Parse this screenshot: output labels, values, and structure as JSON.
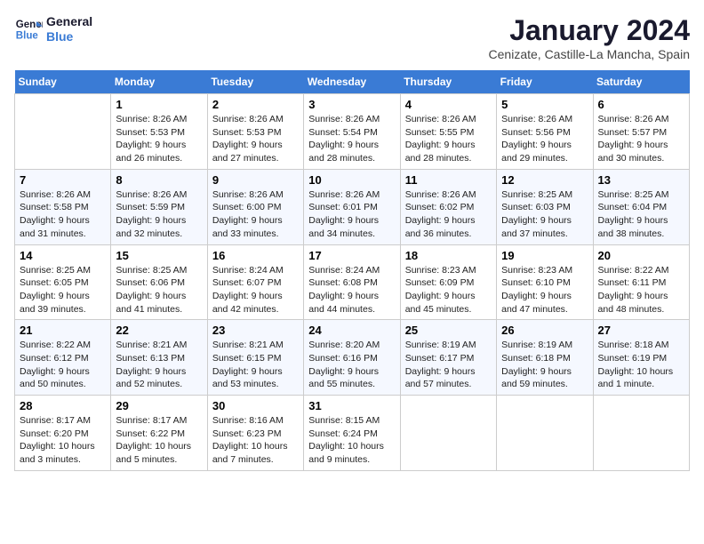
{
  "header": {
    "logo_line1": "General",
    "logo_line2": "Blue",
    "month_year": "January 2024",
    "location": "Cenizate, Castille-La Mancha, Spain"
  },
  "weekdays": [
    "Sunday",
    "Monday",
    "Tuesday",
    "Wednesday",
    "Thursday",
    "Friday",
    "Saturday"
  ],
  "weeks": [
    [
      {
        "num": "",
        "empty": true
      },
      {
        "num": "1",
        "sunrise": "8:26 AM",
        "sunset": "5:53 PM",
        "daylight": "9 hours and 26 minutes."
      },
      {
        "num": "2",
        "sunrise": "8:26 AM",
        "sunset": "5:53 PM",
        "daylight": "9 hours and 27 minutes."
      },
      {
        "num": "3",
        "sunrise": "8:26 AM",
        "sunset": "5:54 PM",
        "daylight": "9 hours and 28 minutes."
      },
      {
        "num": "4",
        "sunrise": "8:26 AM",
        "sunset": "5:55 PM",
        "daylight": "9 hours and 28 minutes."
      },
      {
        "num": "5",
        "sunrise": "8:26 AM",
        "sunset": "5:56 PM",
        "daylight": "9 hours and 29 minutes."
      },
      {
        "num": "6",
        "sunrise": "8:26 AM",
        "sunset": "5:57 PM",
        "daylight": "9 hours and 30 minutes."
      }
    ],
    [
      {
        "num": "7",
        "sunrise": "8:26 AM",
        "sunset": "5:58 PM",
        "daylight": "9 hours and 31 minutes."
      },
      {
        "num": "8",
        "sunrise": "8:26 AM",
        "sunset": "5:59 PM",
        "daylight": "9 hours and 32 minutes."
      },
      {
        "num": "9",
        "sunrise": "8:26 AM",
        "sunset": "6:00 PM",
        "daylight": "9 hours and 33 minutes."
      },
      {
        "num": "10",
        "sunrise": "8:26 AM",
        "sunset": "6:01 PM",
        "daylight": "9 hours and 34 minutes."
      },
      {
        "num": "11",
        "sunrise": "8:26 AM",
        "sunset": "6:02 PM",
        "daylight": "9 hours and 36 minutes."
      },
      {
        "num": "12",
        "sunrise": "8:25 AM",
        "sunset": "6:03 PM",
        "daylight": "9 hours and 37 minutes."
      },
      {
        "num": "13",
        "sunrise": "8:25 AM",
        "sunset": "6:04 PM",
        "daylight": "9 hours and 38 minutes."
      }
    ],
    [
      {
        "num": "14",
        "sunrise": "8:25 AM",
        "sunset": "6:05 PM",
        "daylight": "9 hours and 39 minutes."
      },
      {
        "num": "15",
        "sunrise": "8:25 AM",
        "sunset": "6:06 PM",
        "daylight": "9 hours and 41 minutes."
      },
      {
        "num": "16",
        "sunrise": "8:24 AM",
        "sunset": "6:07 PM",
        "daylight": "9 hours and 42 minutes."
      },
      {
        "num": "17",
        "sunrise": "8:24 AM",
        "sunset": "6:08 PM",
        "daylight": "9 hours and 44 minutes."
      },
      {
        "num": "18",
        "sunrise": "8:23 AM",
        "sunset": "6:09 PM",
        "daylight": "9 hours and 45 minutes."
      },
      {
        "num": "19",
        "sunrise": "8:23 AM",
        "sunset": "6:10 PM",
        "daylight": "9 hours and 47 minutes."
      },
      {
        "num": "20",
        "sunrise": "8:22 AM",
        "sunset": "6:11 PM",
        "daylight": "9 hours and 48 minutes."
      }
    ],
    [
      {
        "num": "21",
        "sunrise": "8:22 AM",
        "sunset": "6:12 PM",
        "daylight": "9 hours and 50 minutes."
      },
      {
        "num": "22",
        "sunrise": "8:21 AM",
        "sunset": "6:13 PM",
        "daylight": "9 hours and 52 minutes."
      },
      {
        "num": "23",
        "sunrise": "8:21 AM",
        "sunset": "6:15 PM",
        "daylight": "9 hours and 53 minutes."
      },
      {
        "num": "24",
        "sunrise": "8:20 AM",
        "sunset": "6:16 PM",
        "daylight": "9 hours and 55 minutes."
      },
      {
        "num": "25",
        "sunrise": "8:19 AM",
        "sunset": "6:17 PM",
        "daylight": "9 hours and 57 minutes."
      },
      {
        "num": "26",
        "sunrise": "8:19 AM",
        "sunset": "6:18 PM",
        "daylight": "9 hours and 59 minutes."
      },
      {
        "num": "27",
        "sunrise": "8:18 AM",
        "sunset": "6:19 PM",
        "daylight": "10 hours and 1 minute."
      }
    ],
    [
      {
        "num": "28",
        "sunrise": "8:17 AM",
        "sunset": "6:20 PM",
        "daylight": "10 hours and 3 minutes."
      },
      {
        "num": "29",
        "sunrise": "8:17 AM",
        "sunset": "6:22 PM",
        "daylight": "10 hours and 5 minutes."
      },
      {
        "num": "30",
        "sunrise": "8:16 AM",
        "sunset": "6:23 PM",
        "daylight": "10 hours and 7 minutes."
      },
      {
        "num": "31",
        "sunrise": "8:15 AM",
        "sunset": "6:24 PM",
        "daylight": "10 hours and 9 minutes."
      },
      {
        "num": "",
        "empty": true
      },
      {
        "num": "",
        "empty": true
      },
      {
        "num": "",
        "empty": true
      }
    ]
  ],
  "labels": {
    "sunrise_prefix": "Sunrise: ",
    "sunset_prefix": "Sunset: ",
    "daylight_prefix": "Daylight: "
  }
}
